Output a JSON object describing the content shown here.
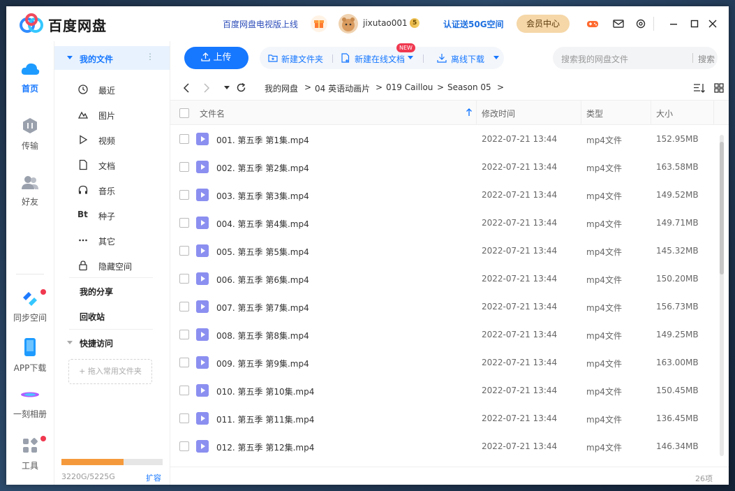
{
  "titlebar": {
    "app_title": "百度网盘",
    "tv_link": "百度网盘电视版上线",
    "username": "jixutao001",
    "vip_badge": "5",
    "verify_link": "认证送50G空间",
    "member_button": "会员中心"
  },
  "colors": {
    "accent": "#1677ff",
    "member_bg": "#f5d7a8",
    "storage_fill": "#f59a3c",
    "file_icon": "#8b8ff0",
    "new_badge": "#f0384f"
  },
  "leftnav": {
    "home": "首页",
    "transfer": "传输",
    "friends": "好友",
    "sync": "同步空间",
    "app_download": "APP下载",
    "album": "一刻相册",
    "tools": "工具"
  },
  "sidebar": {
    "my_files": "我的文件",
    "items": [
      {
        "label": "最近",
        "icon": "clock-icon"
      },
      {
        "label": "图片",
        "icon": "image-icon"
      },
      {
        "label": "视频",
        "icon": "play-icon"
      },
      {
        "label": "文档",
        "icon": "document-icon"
      },
      {
        "label": "音乐",
        "icon": "headphones-icon"
      },
      {
        "label": "种子",
        "icon": "bt-icon"
      },
      {
        "label": "其它",
        "icon": "more-icon"
      },
      {
        "label": "隐藏空间",
        "icon": "lock-icon"
      }
    ],
    "my_share": "我的分享",
    "recycle": "回收站",
    "quick_access": "快捷访问",
    "drag_folder": "+ 拖入常用文件夹",
    "storage_text": "3220G/5225G",
    "storage_fraction": 0.616,
    "expand": "扩容"
  },
  "toolbar": {
    "upload": "上传",
    "new_folder": "新建文件夹",
    "new_online_doc": "新建在线文档",
    "new_badge": "NEW",
    "offline_download": "离线下载",
    "search_placeholder": "搜索我的网盘文件",
    "search_button": "搜索"
  },
  "path": {
    "segments": [
      "我的网盘",
      "04 英语动画片",
      "019 Caillou",
      "Season 05"
    ],
    "sep": ">"
  },
  "table": {
    "headers": {
      "name": "文件名",
      "modified": "修改时间",
      "type": "类型",
      "size": "大小"
    },
    "rows": [
      {
        "name": "001. 第五季 第1集.mp4",
        "modified": "2022-07-21 13:44",
        "type": "mp4文件",
        "size": "152.95MB"
      },
      {
        "name": "002. 第五季 第2集.mp4",
        "modified": "2022-07-21 13:44",
        "type": "mp4文件",
        "size": "163.58MB"
      },
      {
        "name": "003. 第五季 第3集.mp4",
        "modified": "2022-07-21 13:44",
        "type": "mp4文件",
        "size": "149.52MB"
      },
      {
        "name": "004. 第五季 第4集.mp4",
        "modified": "2022-07-21 13:44",
        "type": "mp4文件",
        "size": "149.71MB"
      },
      {
        "name": "005. 第五季 第5集.mp4",
        "modified": "2022-07-21 13:44",
        "type": "mp4文件",
        "size": "145.32MB"
      },
      {
        "name": "006. 第五季 第6集.mp4",
        "modified": "2022-07-21 13:44",
        "type": "mp4文件",
        "size": "150.20MB"
      },
      {
        "name": "007. 第五季 第7集.mp4",
        "modified": "2022-07-21 13:44",
        "type": "mp4文件",
        "size": "156.73MB"
      },
      {
        "name": "008. 第五季 第8集.mp4",
        "modified": "2022-07-21 13:44",
        "type": "mp4文件",
        "size": "149.25MB"
      },
      {
        "name": "009. 第五季 第9集.mp4",
        "modified": "2022-07-21 13:44",
        "type": "mp4文件",
        "size": "163.00MB"
      },
      {
        "name": "010. 第五季 第10集.mp4",
        "modified": "2022-07-21 13:44",
        "type": "mp4文件",
        "size": "150.45MB"
      },
      {
        "name": "011. 第五季 第11集.mp4",
        "modified": "2022-07-21 13:44",
        "type": "mp4文件",
        "size": "136.45MB"
      },
      {
        "name": "012. 第五季 第12集.mp4",
        "modified": "2022-07-21 13:44",
        "type": "mp4文件",
        "size": "146.34MB"
      }
    ]
  },
  "footer": {
    "count": "26项"
  }
}
